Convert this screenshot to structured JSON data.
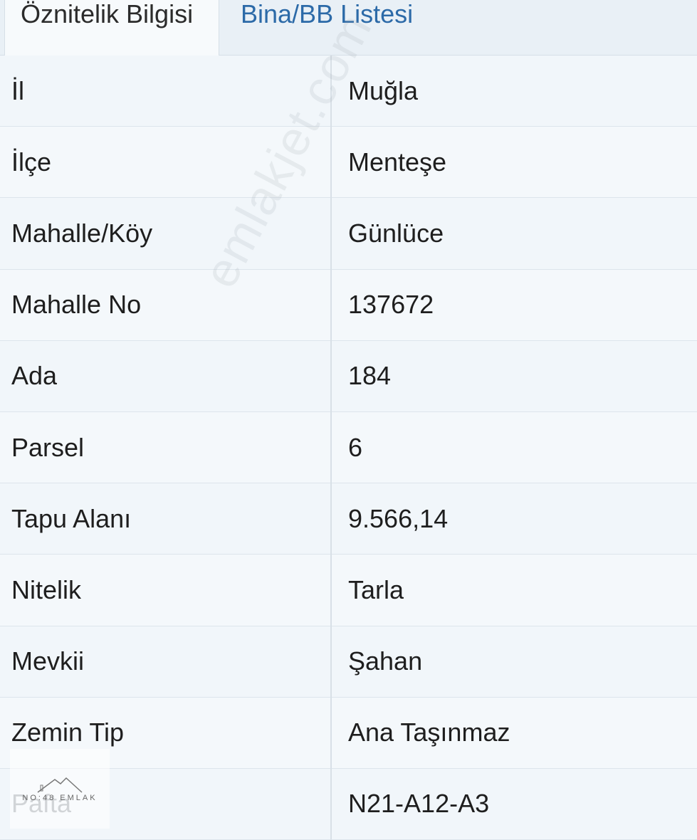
{
  "tabs": [
    {
      "label": "Öznitelik Bilgisi",
      "active": true
    },
    {
      "label": "Bina/BB Listesi",
      "active": false
    }
  ],
  "rows": [
    {
      "label": "İl",
      "value": "Muğla"
    },
    {
      "label": "İlçe",
      "value": "Menteşe"
    },
    {
      "label": "Mahalle/Köy",
      "value": "Günlüce"
    },
    {
      "label": "Mahalle No",
      "value": "137672"
    },
    {
      "label": "Ada",
      "value": "184"
    },
    {
      "label": "Parsel",
      "value": "6"
    },
    {
      "label": "Tapu Alanı",
      "value": "9.566,14"
    },
    {
      "label": "Nitelik",
      "value": "Tarla"
    },
    {
      "label": "Mevkii",
      "value": "Şahan"
    },
    {
      "label": "Zemin Tip",
      "value": "Ana Taşınmaz"
    },
    {
      "label": "Pafta",
      "value": "N21-A12-A3"
    }
  ],
  "watermark": "emlakjet.com",
  "logo": {
    "text": "NO:48 EMLAK"
  },
  "colors": {
    "tab_active_text": "#2b2b2b",
    "tab_inactive_text": "#2c6aa8",
    "row_bg": "#f4f8fb",
    "divider": "#dde5ec"
  }
}
